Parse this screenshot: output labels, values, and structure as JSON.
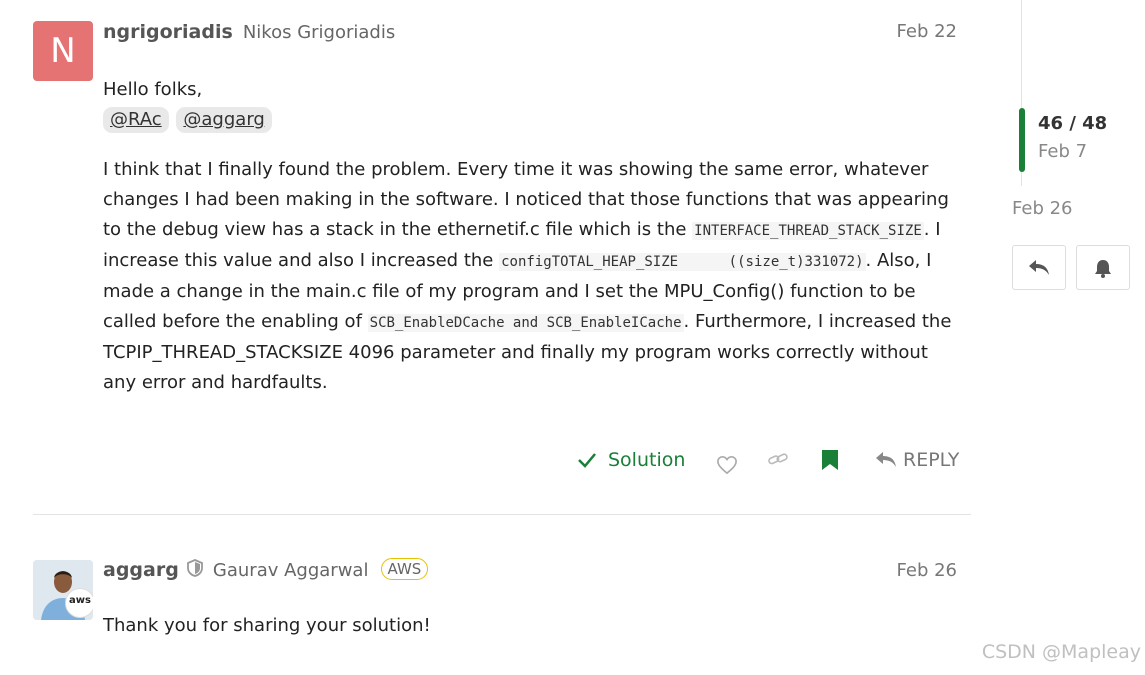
{
  "post1": {
    "avatar_letter": "N",
    "username": "ngrigoriadis",
    "fullname": "Nikos Grigoriadis",
    "date": "Feb 22",
    "greeting": "Hello folks,",
    "mentions": [
      "@RAc",
      "@aggarg"
    ],
    "body": {
      "t1": "I think that I finally found the problem. Every time it was showing the same error, whatever changes I had been making in the software. I noticed that those functions that was appearing to the debug view has a stack in the ethernetif.c file which is the ",
      "c1": "INTERFACE_THREAD_STACK_SIZE",
      "t2": ". I increase this value and also I increased the ",
      "c2": "configTOTAL_HEAP_SIZE      ((size_t)331072)",
      "t3": ". Also, I made a change in the main.c file of my program and I set the MPU_Config() function to be called before the enabling of ",
      "c3": "SCB_EnableDCache and SCB_EnableICache",
      "t4": ". Furthermore, I increased the TCPIP_THREAD_STACKSIZE 4096 parameter and finally my program works correctly without any error and hardfaults."
    },
    "actions": {
      "solution_label": "Solution",
      "reply_label": "REPLY"
    }
  },
  "post2": {
    "username": "aggarg",
    "fullname": "Gaurav Aggarwal",
    "flair": "AWS",
    "avatar_badge": "aws",
    "date": "Feb 26",
    "body": "Thank you for sharing your solution!"
  },
  "timeline": {
    "position": "46 / 48",
    "position_date": "Feb 7",
    "end_date": "Feb 26"
  },
  "watermark": "CSDN @Mapleay",
  "colors": {
    "accent": "#1a7f37",
    "avatar_bg": "#e57373",
    "aws_flair_border": "#e4c200"
  }
}
